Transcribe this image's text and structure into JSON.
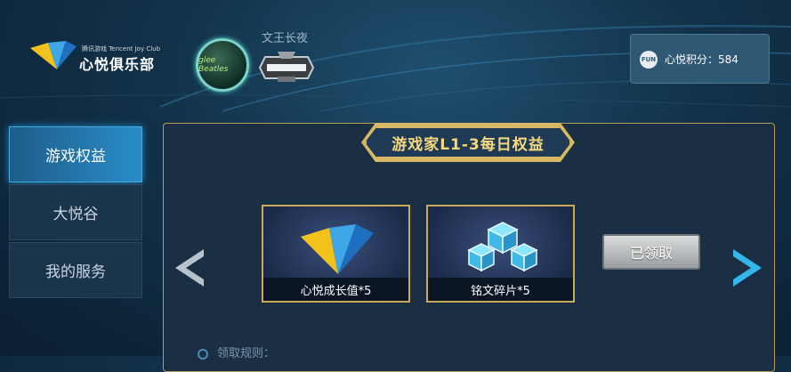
{
  "header": {
    "logo_sub": "腾讯游戏 Tencent Joy Club",
    "logo_main": "心悦俱乐部",
    "avatar_text": "glee Beatles",
    "username": "文王长夜",
    "rank_badge": "rank-badge-icon",
    "points_icon_text": "FUN",
    "points_label": "心悦积分：584"
  },
  "sidebar": {
    "items": [
      {
        "label": "游戏权益",
        "active": true
      },
      {
        "label": "大悦谷",
        "active": false
      },
      {
        "label": "我的服务",
        "active": false
      }
    ]
  },
  "main": {
    "title": "游戏家L1-3每日权益",
    "rewards": [
      {
        "label": "心悦成长值*5",
        "icon": "vip-logo-icon"
      },
      {
        "label": "铭文碎片*5",
        "icon": "ice-cubes-icon"
      }
    ],
    "claim_button": "已领取",
    "rules_label": "领取规则："
  },
  "colors": {
    "accent_gold": "#d8b765",
    "active_tab": "#2a8cc8",
    "arrow_blue": "#35b6ea"
  }
}
